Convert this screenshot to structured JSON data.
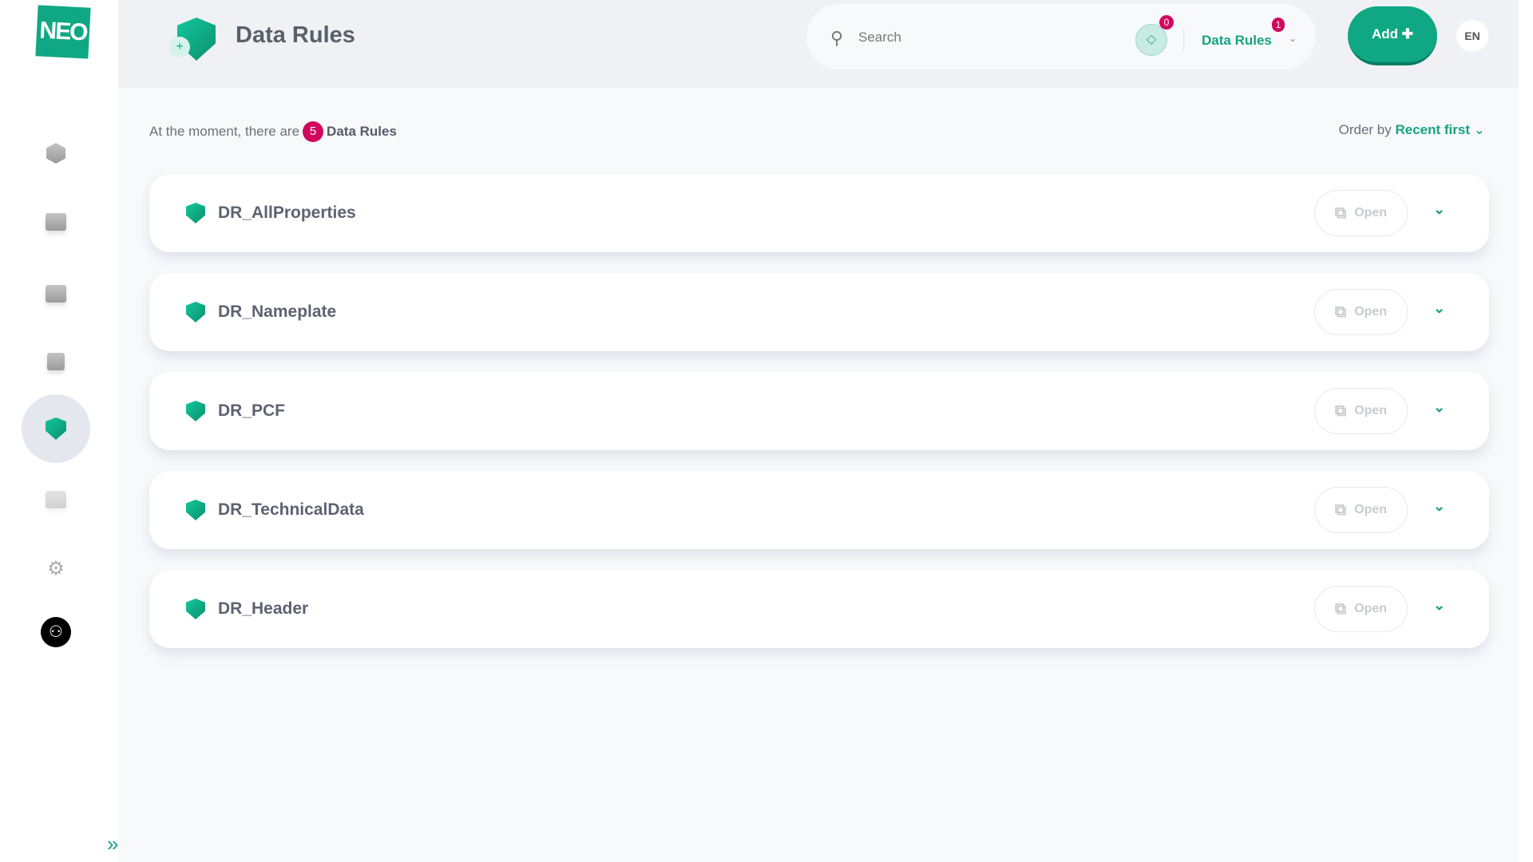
{
  "app": {
    "logo": "NEO",
    "title": "Data Rules"
  },
  "sidebar": {
    "items": [
      {
        "name": "models",
        "icon": "cube-icon"
      },
      {
        "name": "folders",
        "icon": "folder-icon"
      },
      {
        "name": "cards",
        "icon": "cards-icon"
      },
      {
        "name": "edit",
        "icon": "edit-icon"
      },
      {
        "name": "data-rules",
        "icon": "shield-icon",
        "active": true
      },
      {
        "name": "documents",
        "icon": "document-icon"
      },
      {
        "name": "settings",
        "icon": "gear-icon"
      },
      {
        "name": "profile",
        "icon": "user-icon"
      }
    ],
    "expand_icon": "»"
  },
  "header": {
    "search_placeholder": "Search",
    "tag_count": "0",
    "context_label": "Data Rules",
    "context_count": "1",
    "add_label": "Add ✚",
    "language": "EN"
  },
  "summary": {
    "prefix": "At the moment, there are",
    "count": "5",
    "suffix": "Data Rules",
    "order_label": "Order by",
    "order_value": "Recent first"
  },
  "rules": [
    {
      "name": "DR_AllProperties",
      "open_label": "Open"
    },
    {
      "name": "DR_Nameplate",
      "open_label": "Open"
    },
    {
      "name": "DR_PCF",
      "open_label": "Open"
    },
    {
      "name": "DR_TechnicalData",
      "open_label": "Open"
    },
    {
      "name": "DR_Header",
      "open_label": "Open"
    }
  ],
  "colors": {
    "accent": "#10a884",
    "badge": "#d1085f"
  }
}
